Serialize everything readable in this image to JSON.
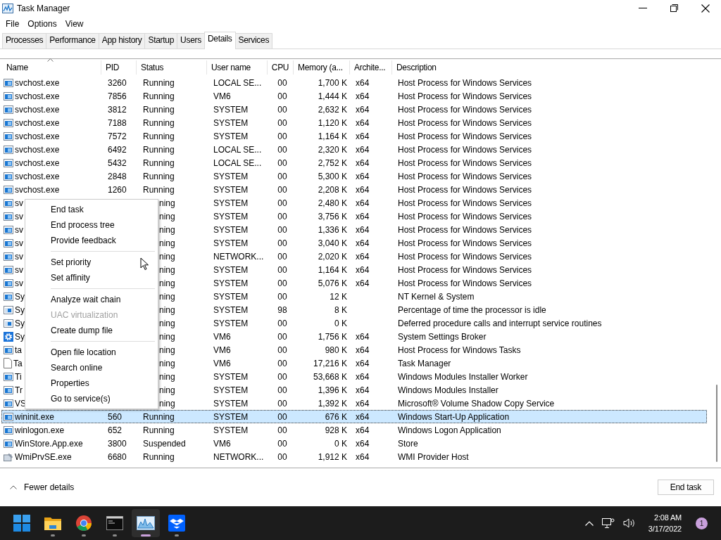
{
  "window": {
    "title": "Task Manager"
  },
  "menu": [
    "File",
    "Options",
    "View"
  ],
  "tabs": [
    {
      "label": "Processes",
      "selected": false
    },
    {
      "label": "Performance",
      "selected": false
    },
    {
      "label": "App history",
      "selected": false
    },
    {
      "label": "Startup",
      "selected": false
    },
    {
      "label": "Users",
      "selected": false
    },
    {
      "label": "Details",
      "selected": true
    },
    {
      "label": "Services",
      "selected": false
    }
  ],
  "table": {
    "columns": [
      "Name",
      "PID",
      "Status",
      "User name",
      "CPU",
      "Memory (a...",
      "Archite...",
      "Description"
    ],
    "rows": [
      {
        "kind": "window",
        "name": "svchost.exe",
        "pid": "3260",
        "status": "Running",
        "user": "LOCAL SE...",
        "cpu": "00",
        "memory": "1,700 K",
        "arch": "x64",
        "description": "Host Process for Windows Services",
        "selected": false
      },
      {
        "kind": "window",
        "name": "svchost.exe",
        "pid": "7856",
        "status": "Running",
        "user": "VM6",
        "cpu": "00",
        "memory": "1,444 K",
        "arch": "x64",
        "description": "Host Process for Windows Services",
        "selected": false
      },
      {
        "kind": "window",
        "name": "svchost.exe",
        "pid": "3812",
        "status": "Running",
        "user": "SYSTEM",
        "cpu": "00",
        "memory": "2,632 K",
        "arch": "x64",
        "description": "Host Process for Windows Services",
        "selected": false
      },
      {
        "kind": "window",
        "name": "svchost.exe",
        "pid": "7188",
        "status": "Running",
        "user": "SYSTEM",
        "cpu": "00",
        "memory": "1,120 K",
        "arch": "x64",
        "description": "Host Process for Windows Services",
        "selected": false
      },
      {
        "kind": "window",
        "name": "svchost.exe",
        "pid": "7572",
        "status": "Running",
        "user": "SYSTEM",
        "cpu": "00",
        "memory": "1,164 K",
        "arch": "x64",
        "description": "Host Process for Windows Services",
        "selected": false
      },
      {
        "kind": "window",
        "name": "svchost.exe",
        "pid": "6492",
        "status": "Running",
        "user": "LOCAL SE...",
        "cpu": "00",
        "memory": "2,320 K",
        "arch": "x64",
        "description": "Host Process for Windows Services",
        "selected": false
      },
      {
        "kind": "window",
        "name": "svchost.exe",
        "pid": "5432",
        "status": "Running",
        "user": "LOCAL SE...",
        "cpu": "00",
        "memory": "2,752 K",
        "arch": "x64",
        "description": "Host Process for Windows Services",
        "selected": false
      },
      {
        "kind": "window",
        "name": "svchost.exe",
        "pid": "2848",
        "status": "Running",
        "user": "SYSTEM",
        "cpu": "00",
        "memory": "5,300 K",
        "arch": "x64",
        "description": "Host Process for Windows Services",
        "selected": false
      },
      {
        "kind": "window",
        "name": "svchost.exe",
        "pid": "1260",
        "status": "Running",
        "user": "SYSTEM",
        "cpu": "00",
        "memory": "2,208 K",
        "arch": "x64",
        "description": "Host Process for Windows Services",
        "selected": false
      },
      {
        "kind": "window",
        "name": "sv",
        "status": "ning",
        "user": "SYSTEM",
        "cpu": "00",
        "memory": "2,480 K",
        "arch": "x64",
        "description": "Host Process for Windows Services",
        "selected": false
      },
      {
        "kind": "window",
        "name": "sv",
        "status": "ning",
        "user": "SYSTEM",
        "cpu": "00",
        "memory": "3,756 K",
        "arch": "x64",
        "description": "Host Process for Windows Services",
        "selected": false
      },
      {
        "kind": "window",
        "name": "sv",
        "status": "ning",
        "user": "SYSTEM",
        "cpu": "00",
        "memory": "1,336 K",
        "arch": "x64",
        "description": "Host Process for Windows Services",
        "selected": false
      },
      {
        "kind": "window",
        "name": "sv",
        "status": "ning",
        "user": "SYSTEM",
        "cpu": "00",
        "memory": "3,040 K",
        "arch": "x64",
        "description": "Host Process for Windows Services",
        "selected": false
      },
      {
        "kind": "window",
        "name": "sv",
        "status": "ning",
        "user": "NETWORK...",
        "cpu": "00",
        "memory": "2,020 K",
        "arch": "x64",
        "description": "Host Process for Windows Services",
        "selected": false
      },
      {
        "kind": "window",
        "name": "sv",
        "status": "ning",
        "user": "SYSTEM",
        "cpu": "00",
        "memory": "1,164 K",
        "arch": "x64",
        "description": "Host Process for Windows Services",
        "selected": false
      },
      {
        "kind": "window",
        "name": "sv",
        "status": "ning",
        "user": "SYSTEM",
        "cpu": "00",
        "memory": "5,076 K",
        "arch": "x64",
        "description": "Host Process for Windows Services",
        "selected": false
      },
      {
        "kind": "window",
        "name": "Sy",
        "status": "ning",
        "user": "SYSTEM",
        "cpu": "00",
        "memory": "12 K",
        "description": "NT Kernel & System",
        "selected": false
      },
      {
        "kind": "light-window",
        "name": "Sy",
        "status": "ning",
        "user": "SYSTEM",
        "cpu": "98",
        "memory": "8 K",
        "description": "Percentage of time the processor is idle",
        "selected": false
      },
      {
        "kind": "light-window",
        "name": "Sy",
        "status": "ning",
        "user": "SYSTEM",
        "cpu": "00",
        "memory": "0 K",
        "description": "Deferred procedure calls and interrupt service routines",
        "selected": false
      },
      {
        "kind": "gear",
        "name": "Sy",
        "status": "ning",
        "user": "VM6",
        "cpu": "00",
        "memory": "1,756 K",
        "arch": "x64",
        "description": "System Settings Broker",
        "selected": false
      },
      {
        "kind": "window",
        "name": "ta",
        "status": "ning",
        "user": "VM6",
        "cpu": "00",
        "memory": "980 K",
        "arch": "x64",
        "description": "Host Process for Windows Tasks",
        "selected": false
      },
      {
        "kind": "document",
        "name": "Ta",
        "status": "ning",
        "user": "VM6",
        "cpu": "00",
        "memory": "17,216 K",
        "arch": "x64",
        "description": "Task Manager",
        "selected": false
      },
      {
        "kind": "window",
        "name": "Ti",
        "status": "ning",
        "user": "SYSTEM",
        "cpu": "00",
        "memory": "53,668 K",
        "arch": "x64",
        "description": "Windows Modules Installer Worker",
        "selected": false
      },
      {
        "kind": "window",
        "name": "Tr",
        "status": "ning",
        "user": "SYSTEM",
        "cpu": "00",
        "memory": "1,396 K",
        "arch": "x64",
        "description": "Windows Modules Installer",
        "selected": false
      },
      {
        "kind": "window",
        "name": "VS",
        "status": "ning",
        "user": "SYSTEM",
        "cpu": "00",
        "memory": "1,392 K",
        "arch": "x64",
        "description": "Microsoft® Volume Shadow Copy Service",
        "selected": false
      },
      {
        "kind": "window",
        "name": "wininit.exe",
        "pid": "560",
        "status": "Running",
        "user": "SYSTEM",
        "cpu": "00",
        "memory": "676 K",
        "arch": "x64",
        "description": "Windows Start-Up Application",
        "selected": true
      },
      {
        "kind": "window",
        "name": "winlogon.exe",
        "pid": "652",
        "status": "Running",
        "user": "SYSTEM",
        "cpu": "00",
        "memory": "928 K",
        "arch": "x64",
        "description": "Windows Logon Application",
        "selected": false
      },
      {
        "kind": "window",
        "name": "WinStore.App.exe",
        "pid": "3800",
        "status": "Suspended",
        "user": "VM6",
        "cpu": "00",
        "memory": "0 K",
        "arch": "x64",
        "description": "Store",
        "selected": false
      },
      {
        "kind": "tool",
        "name": "WmiPrvSE.exe",
        "pid": "6680",
        "status": "Running",
        "user": "NETWORK...",
        "cpu": "00",
        "memory": "1,912 K",
        "arch": "x64",
        "description": "WMI Provider Host",
        "selected": false
      }
    ]
  },
  "context_menu": {
    "groups": [
      [
        {
          "label": "End task",
          "disabled": false
        },
        {
          "label": "End process tree",
          "disabled": false
        },
        {
          "label": "Provide feedback",
          "disabled": false
        }
      ],
      [
        {
          "label": "Set priority",
          "disabled": false
        },
        {
          "label": "Set affinity",
          "disabled": false
        }
      ],
      [
        {
          "label": "Analyze wait chain",
          "disabled": false
        },
        {
          "label": "UAC virtualization",
          "disabled": true
        },
        {
          "label": "Create dump file",
          "disabled": false
        }
      ],
      [
        {
          "label": "Open file location",
          "disabled": false
        },
        {
          "label": "Search online",
          "disabled": false
        },
        {
          "label": "Properties",
          "disabled": false
        },
        {
          "label": "Go to service(s)",
          "disabled": false
        }
      ]
    ]
  },
  "footer": {
    "toggle": "Fewer details",
    "button": "End task"
  },
  "taskbar": {
    "apps": [
      {
        "kind": "start",
        "selected": false
      },
      {
        "kind": "folder",
        "selected": false
      },
      {
        "kind": "browser",
        "selected": false
      },
      {
        "kind": "terminal",
        "selected": false
      },
      {
        "kind": "monitor",
        "selected": true
      },
      {
        "kind": "box",
        "selected": false
      }
    ],
    "time": "2:08 AM",
    "date": "3/17/2022",
    "badge": "1"
  }
}
